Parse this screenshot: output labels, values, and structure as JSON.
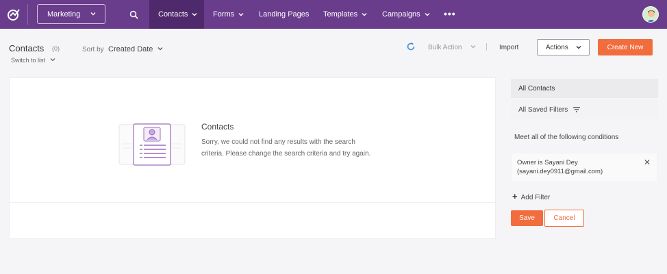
{
  "topbar": {
    "module": "Marketing",
    "nav": [
      {
        "label": "Contacts",
        "dropdown": true,
        "active": true
      },
      {
        "label": "Forms",
        "dropdown": true
      },
      {
        "label": "Landing Pages",
        "dropdown": false
      },
      {
        "label": "Templates",
        "dropdown": true
      },
      {
        "label": "Campaigns",
        "dropdown": true
      }
    ],
    "more": "•••"
  },
  "header": {
    "title": "Contacts",
    "count": "(0)",
    "switch_list": "Switch to list",
    "sort_label": "Sort by",
    "sort_value": "Created Date",
    "bulk_action": "Bulk Action",
    "separator": "|",
    "import": "Import",
    "actions": "Actions",
    "create_new": "Create New"
  },
  "empty_state": {
    "title": "Contacts",
    "message": "Sorry, we could not find any results with the search criteria. Please change the search criteria and try again."
  },
  "filters": {
    "all_contacts": "All Contacts",
    "saved_filters": "All Saved Filters",
    "conditions_label": "Meet all of the following conditions",
    "condition_line1": "Owner is Sayani Dey",
    "condition_line2": "(sayani.dey0911@gmail.com)",
    "add_filter": "Add Filter",
    "save": "Save",
    "cancel": "Cancel"
  },
  "colors": {
    "topbar": "#6a3c8c",
    "active_nav": "#4e2a6c",
    "accent": "#f26d3d"
  }
}
